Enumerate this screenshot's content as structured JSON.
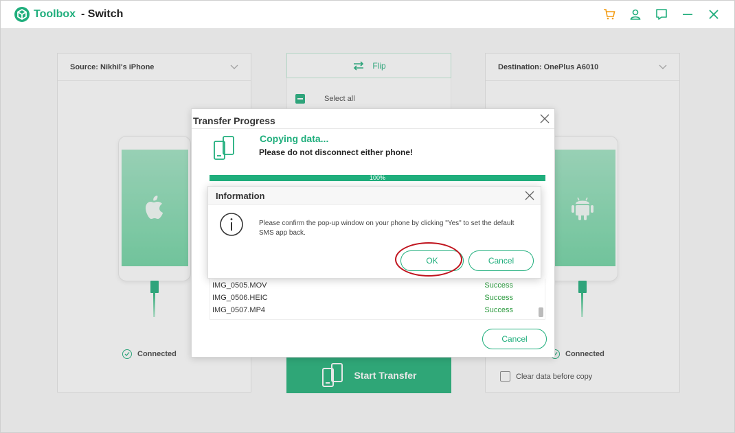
{
  "app": {
    "brand": "Toolbox",
    "subtitle": "- Switch",
    "accent": "#1fae7c",
    "icons": [
      "cart-icon",
      "user-icon",
      "feedback-icon",
      "minimize-icon",
      "close-icon"
    ]
  },
  "source": {
    "label": "Source: Nikhil's iPhone",
    "os_icon": "apple-icon",
    "status": "Connected"
  },
  "destination": {
    "label": "Destination: OnePlus A6010",
    "os_icon": "android-icon",
    "status": "Connected",
    "clear_data_label": "Clear data before copy"
  },
  "middle": {
    "flip_label": "Flip",
    "select_all_label": "Select all",
    "start_label": "Start Transfer"
  },
  "transfer_dialog": {
    "title": "Transfer Progress",
    "status": "Copying data...",
    "warning": "Please do not disconnect either phone!",
    "progress": 100,
    "progress_label": "100%",
    "files": [
      {
        "name": "IMG_0505.MOV",
        "status": "Success"
      },
      {
        "name": "IMG_0506.HEIC",
        "status": "Success"
      },
      {
        "name": "IMG_0507.MP4",
        "status": "Success"
      }
    ],
    "cancel_label": "Cancel"
  },
  "info_dialog": {
    "title": "Information",
    "message": "Please confirm the pop-up window on your phone by clicking \"Yes\" to set the default SMS app back.",
    "ok_label": "OK",
    "cancel_label": "Cancel"
  }
}
